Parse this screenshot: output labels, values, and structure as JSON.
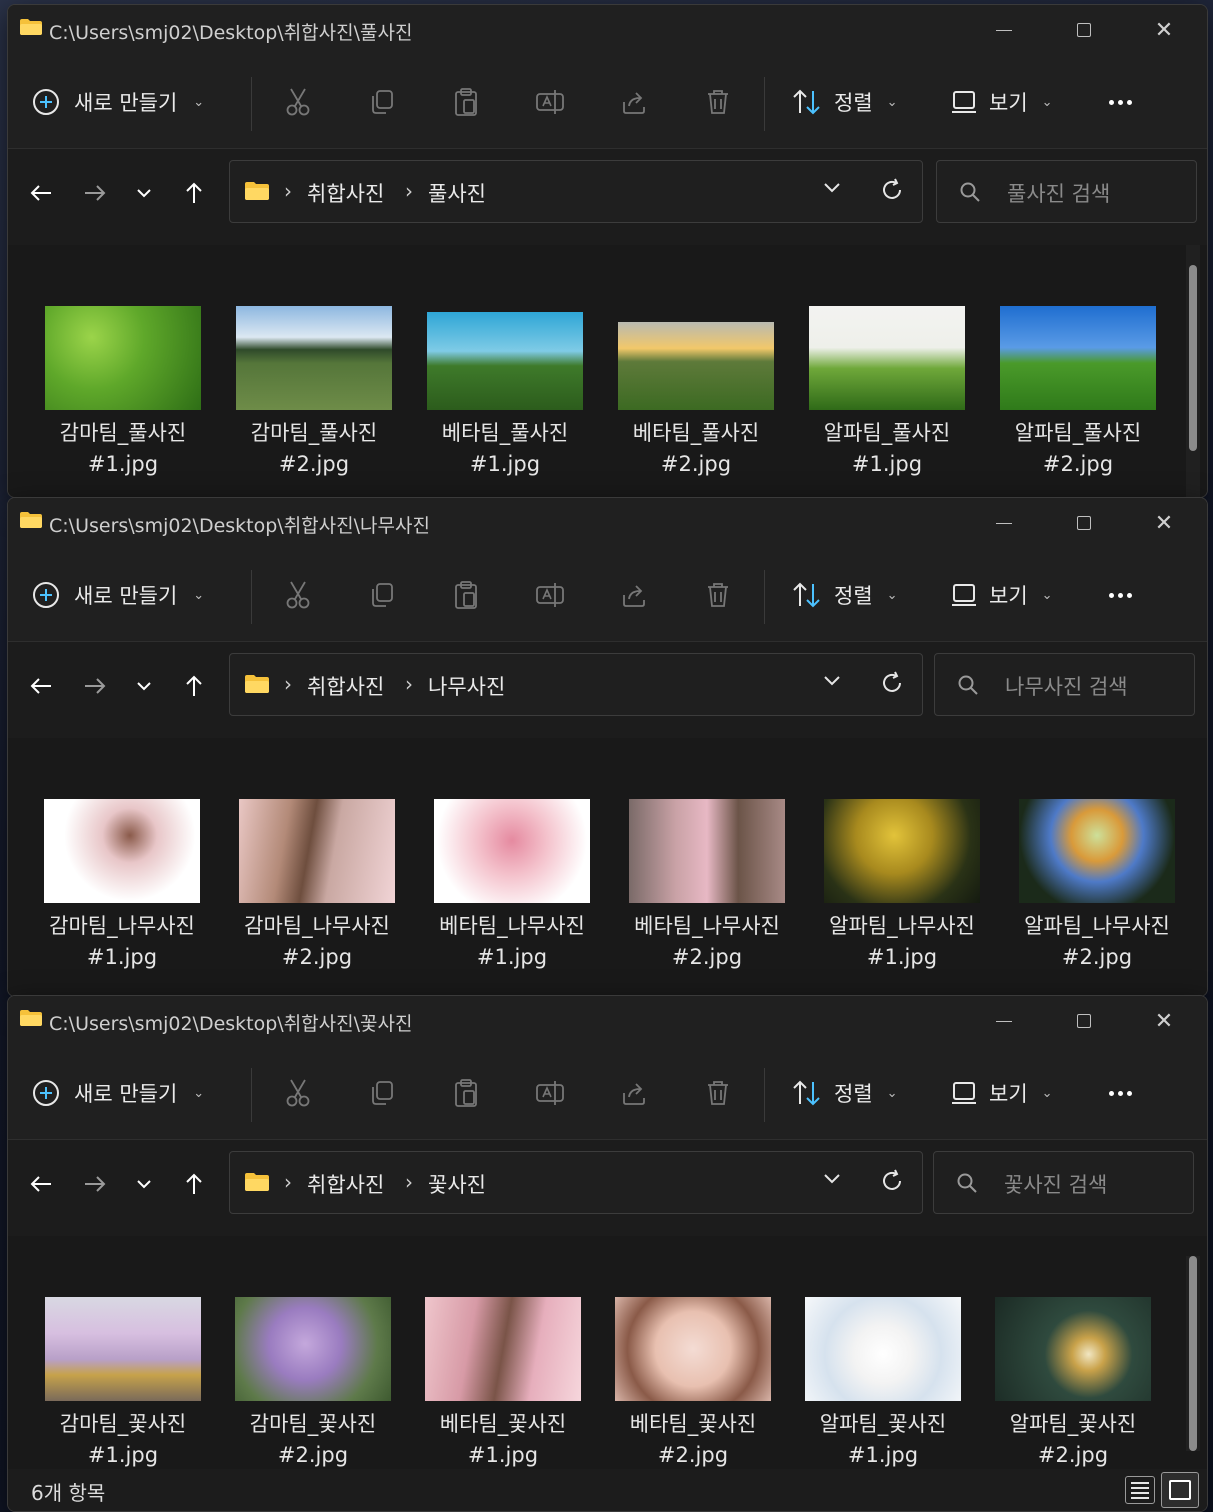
{
  "toolbar": {
    "new_label": "새로 만들기",
    "sort_label": "정렬",
    "view_label": "보기"
  },
  "windows": [
    {
      "title": "C:\\Users\\smj02\\Desktop\\취합사진\\풀사진",
      "crumbs": [
        "취합사진",
        "풀사진"
      ],
      "search_placeholder": "풀사진 검색",
      "items": [
        {
          "line1": "감마팀_풀사진",
          "line2": "#1.jpg"
        },
        {
          "line1": "감마팀_풀사진",
          "line2": "#2.jpg"
        },
        {
          "line1": "베타팀_풀사진",
          "line2": "#1.jpg"
        },
        {
          "line1": "베타팀_풀사진",
          "line2": "#2.jpg"
        },
        {
          "line1": "알파팀_풀사진",
          "line2": "#1.jpg"
        },
        {
          "line1": "알파팀_풀사진",
          "line2": "#2.jpg"
        }
      ]
    },
    {
      "title": "C:\\Users\\smj02\\Desktop\\취합사진\\나무사진",
      "crumbs": [
        "취합사진",
        "나무사진"
      ],
      "search_placeholder": "나무사진 검색",
      "items": [
        {
          "line1": "감마팀_나무사진",
          "line2": "#1.jpg"
        },
        {
          "line1": "감마팀_나무사진",
          "line2": "#2.jpg"
        },
        {
          "line1": "베타팀_나무사진",
          "line2": "#1.jpg"
        },
        {
          "line1": "베타팀_나무사진",
          "line2": "#2.jpg"
        },
        {
          "line1": "알파팀_나무사진",
          "line2": "#1.jpg"
        },
        {
          "line1": "알파팀_나무사진",
          "line2": "#2.jpg"
        }
      ]
    },
    {
      "title": "C:\\Users\\smj02\\Desktop\\취합사진\\꽃사진",
      "crumbs": [
        "취합사진",
        "꽃사진"
      ],
      "search_placeholder": "꽃사진 검색",
      "items": [
        {
          "line1": "감마팀_꽃사진",
          "line2": "#1.jpg"
        },
        {
          "line1": "감마팀_꽃사진",
          "line2": "#2.jpg"
        },
        {
          "line1": "베타팀_꽃사진",
          "line2": "#1.jpg"
        },
        {
          "line1": "베타팀_꽃사진",
          "line2": "#2.jpg"
        },
        {
          "line1": "알파팀_꽃사진",
          "line2": "#1.jpg"
        },
        {
          "line1": "알파팀_꽃사진",
          "line2": "#2.jpg"
        }
      ],
      "status": "6개 항목"
    }
  ],
  "colors": {
    "window_bg": "#1c1c1c",
    "folder_yellow": "#f5c13a",
    "accent_blue": "#4cc2ff"
  },
  "icons": [
    "folder-icon",
    "plus-circle-icon",
    "cut-icon",
    "copy-icon",
    "paste-icon",
    "rename-icon",
    "share-icon",
    "delete-icon",
    "sort-icon",
    "view-icon",
    "more-icon",
    "back-arrow-icon",
    "forward-arrow-icon",
    "recent-chevron-icon",
    "up-arrow-icon",
    "refresh-icon",
    "search-icon",
    "details-view-icon",
    "tiles-view-icon"
  ]
}
